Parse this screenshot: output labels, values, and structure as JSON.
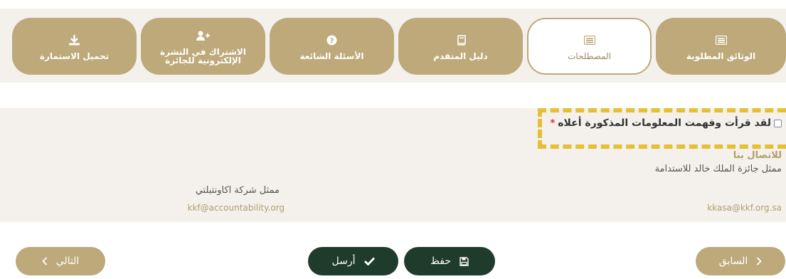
{
  "tabs": [
    {
      "label": "الوثائق المطلوبة",
      "icon": "list-icon"
    },
    {
      "label": "المصطلحات",
      "icon": "list-icon",
      "active": true
    },
    {
      "label": "دليل المتقدم",
      "icon": "book-icon"
    },
    {
      "label": "الأسئلة الشائعة",
      "icon": "question-icon"
    },
    {
      "label": "الاشتراك في النشرة الإلكترونية للجائزة",
      "icon": "add-user-icon"
    },
    {
      "label": "تحميل الاستمارة",
      "icon": "download-icon"
    }
  ],
  "confirm": {
    "label": "لقد قرأت وفهمت المعلومات المذكورة أعلاه",
    "required_mark": "*"
  },
  "contact": {
    "title": "للاتصال بنا",
    "rep_prize": "ممثل جائزة الملك خالد للاستدامة",
    "rep_company": "ممثل شركة اكاونتبلتي",
    "email_prize": "kkasa@kkf.org.sa",
    "email_company": "kkf@accountability.org"
  },
  "buttons": {
    "back": "السابق",
    "save": "حفظ",
    "send": "أرسل",
    "next": "التالي"
  },
  "colors": {
    "gold": "#bda97a",
    "dark_green": "#1f3b2c",
    "highlight": "#e5bf34",
    "panel_bg": "#f4f1ec"
  }
}
